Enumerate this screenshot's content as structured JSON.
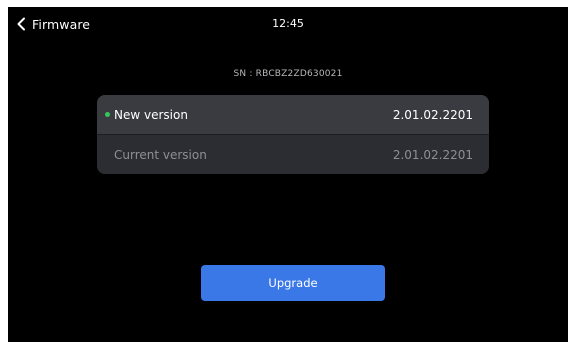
{
  "header": {
    "back_icon": "chevron-left-icon",
    "title": "Firmware",
    "time": "12:45"
  },
  "device": {
    "serial": "SN : RBCBZ2ZD630021"
  },
  "versions": {
    "new": {
      "label": "New version",
      "value": "2.01.02.2201",
      "indicator_color": "#34c759"
    },
    "current": {
      "label": "Current version",
      "value": "2.01.02.2201"
    }
  },
  "actions": {
    "upgrade_label": "Upgrade",
    "upgrade_color": "#3a78e8"
  }
}
